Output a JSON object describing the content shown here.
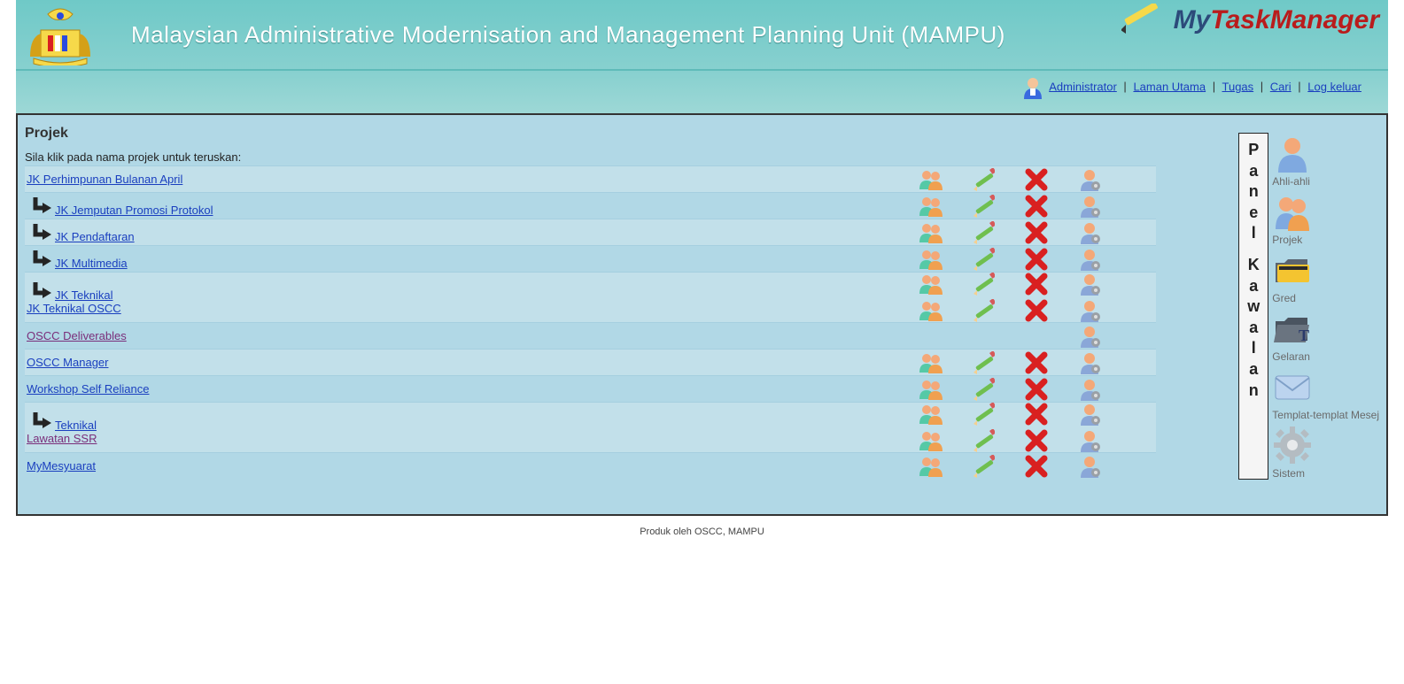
{
  "header": {
    "title": "Malaysian Administrative Modernisation and Management Planning Unit (MAMPU)",
    "logo_my": "My",
    "logo_task": "Task",
    "logo_manager": "Manager"
  },
  "topnav": {
    "admin": "Administrator",
    "home": "Laman Utama",
    "tasks": "Tugas",
    "search": "Cari",
    "logout": "Log keluar"
  },
  "section": {
    "title": "Projek",
    "hint": "Sila klik pada nama projek untuk teruskan:"
  },
  "projects": {
    "r0": {
      "name": "JK Perhimpunan Bulanan April"
    },
    "r1": {
      "name": "JK Jemputan Promosi Protokol"
    },
    "r2": {
      "name": "JK Pendaftaran"
    },
    "r3": {
      "name": "JK Multimedia"
    },
    "r4": {
      "name": "JK Teknikal"
    },
    "r5": {
      "name": "JK Teknikal OSCC"
    },
    "r6": {
      "name": "OSCC Deliverables"
    },
    "r7": {
      "name": "OSCC Manager"
    },
    "r8": {
      "name": "Workshop Self Reliance"
    },
    "r9": {
      "name": "Teknikal"
    },
    "r10": {
      "name": "Lawatan SSR"
    },
    "r11": {
      "name": "MyMesyuarat"
    }
  },
  "panel": {
    "title_chars": [
      "P",
      "a",
      "n",
      "e",
      "l",
      "",
      "K",
      "a",
      "w",
      "a",
      "l",
      "a",
      "n"
    ],
    "members": "Ahli-ahli",
    "project": "Projek",
    "grade": "Gred",
    "title_item": "Gelaran",
    "msgtpl": "Templat-templat Mesej",
    "system": "Sistem"
  },
  "footer": {
    "text": "Produk oleh OSCC, MAMPU"
  }
}
